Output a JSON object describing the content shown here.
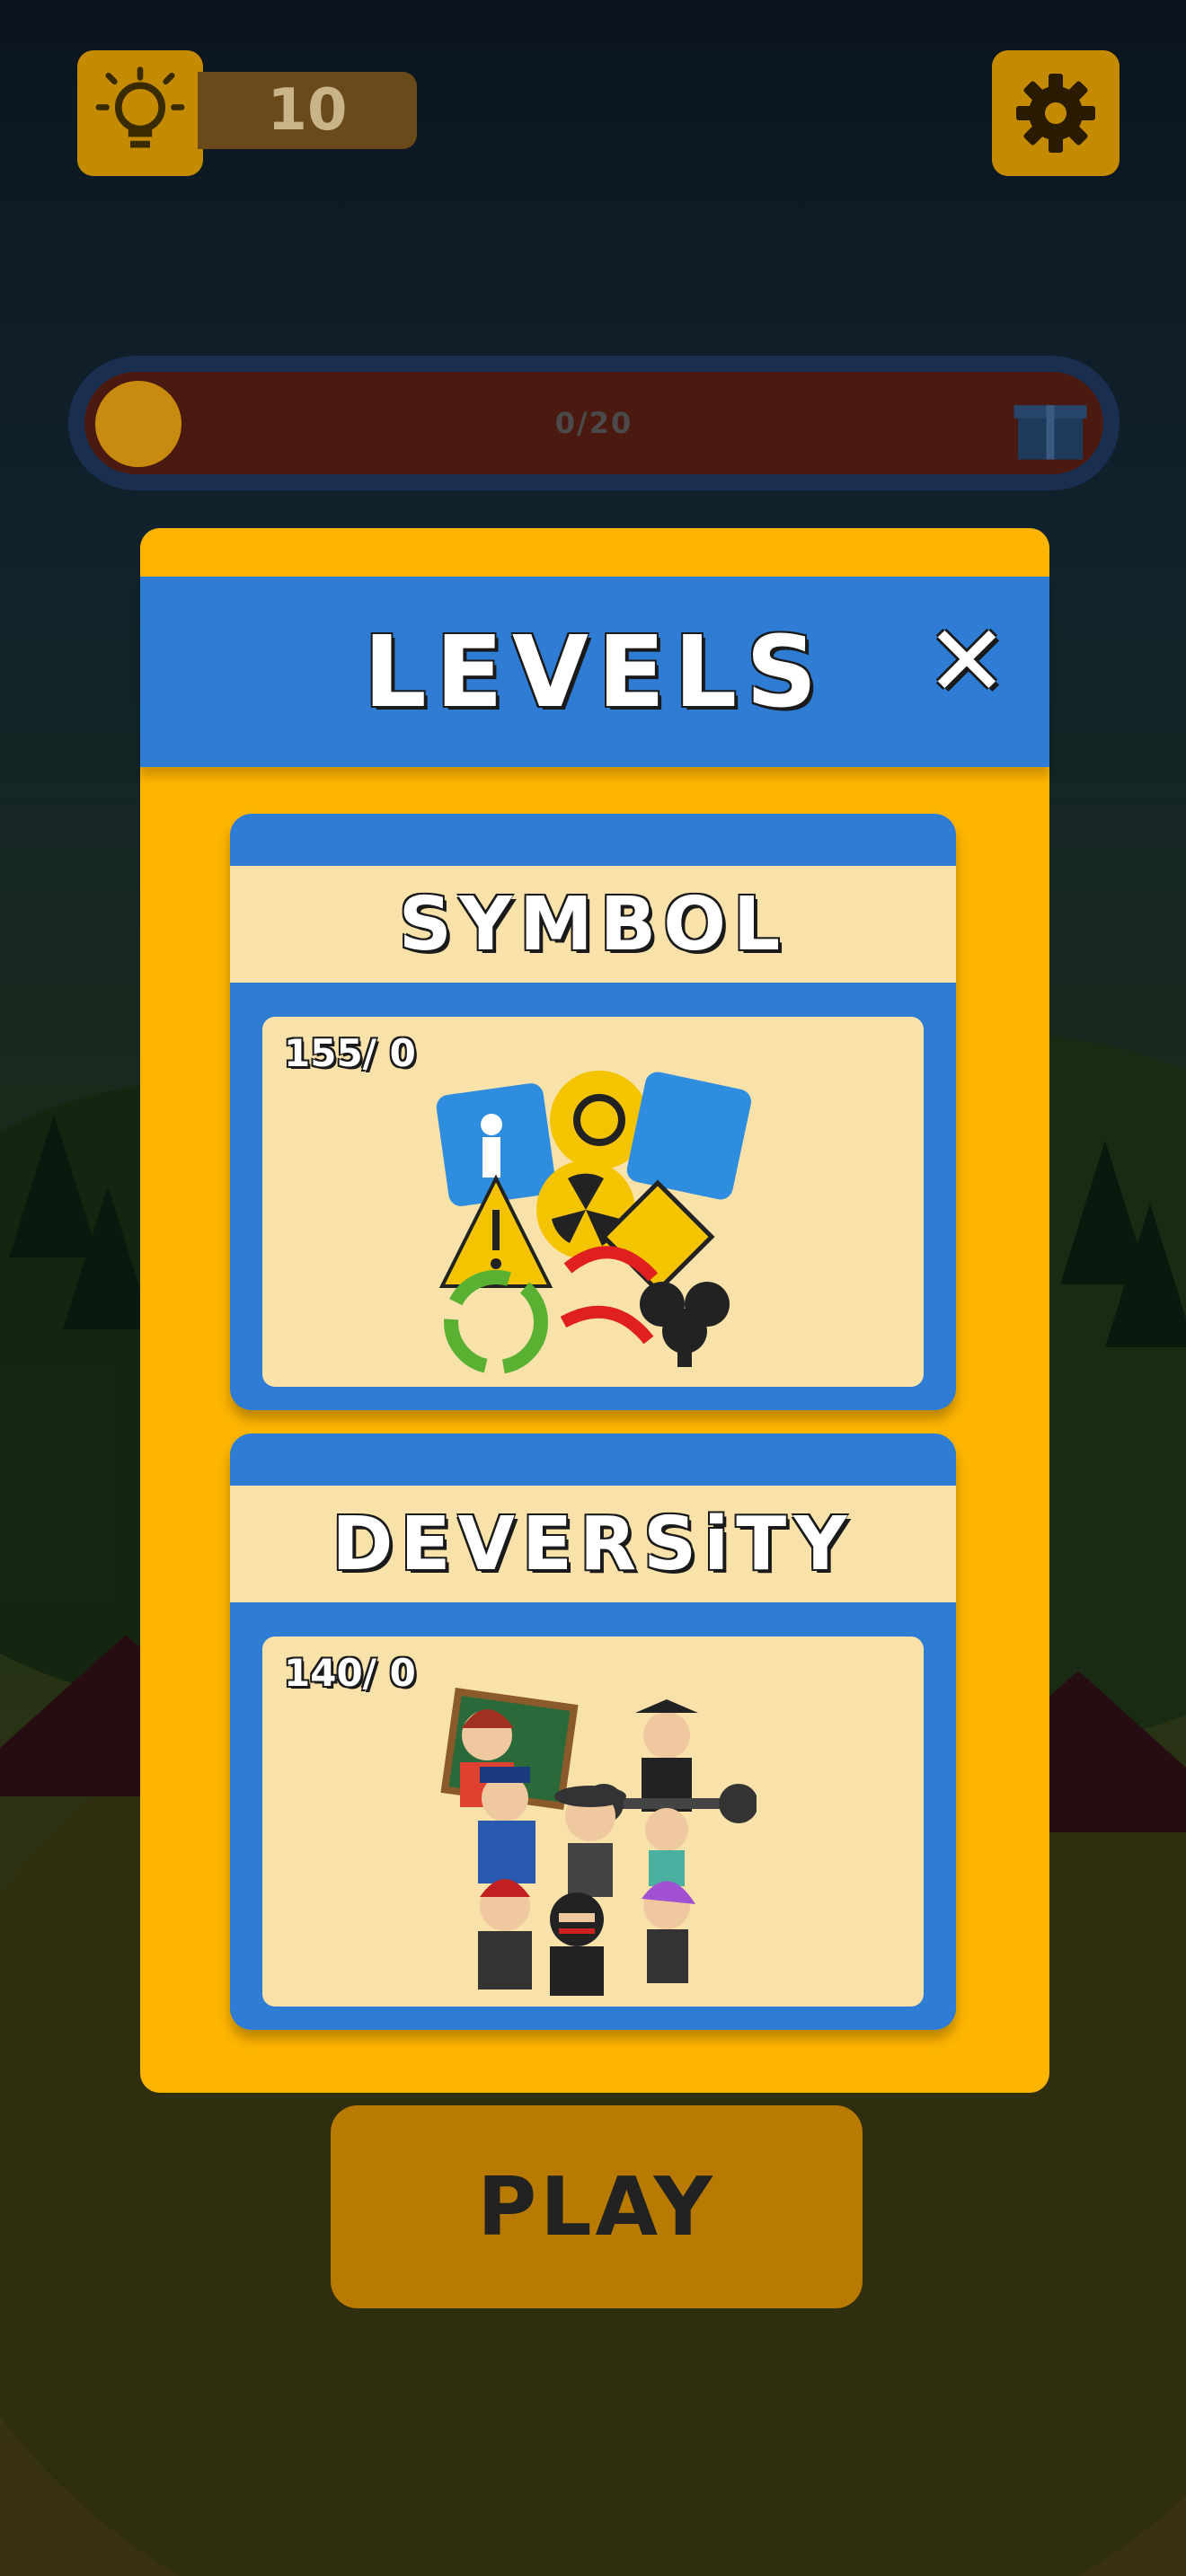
{
  "hud": {
    "hint_count": "10",
    "progress_text": "0/20"
  },
  "modal": {
    "title": "LEVELS",
    "close_label": "✕",
    "levels": [
      {
        "name": "SYMBOL",
        "count": "155/ 0"
      },
      {
        "name": "DEVERSiTY",
        "count": "140/ 0"
      }
    ]
  },
  "play_button": {
    "label": "PLAY"
  },
  "colors": {
    "modal_bg": "#fdb402",
    "header_blue": "#2e7cd4",
    "card_cream": "#f9e2aa"
  }
}
